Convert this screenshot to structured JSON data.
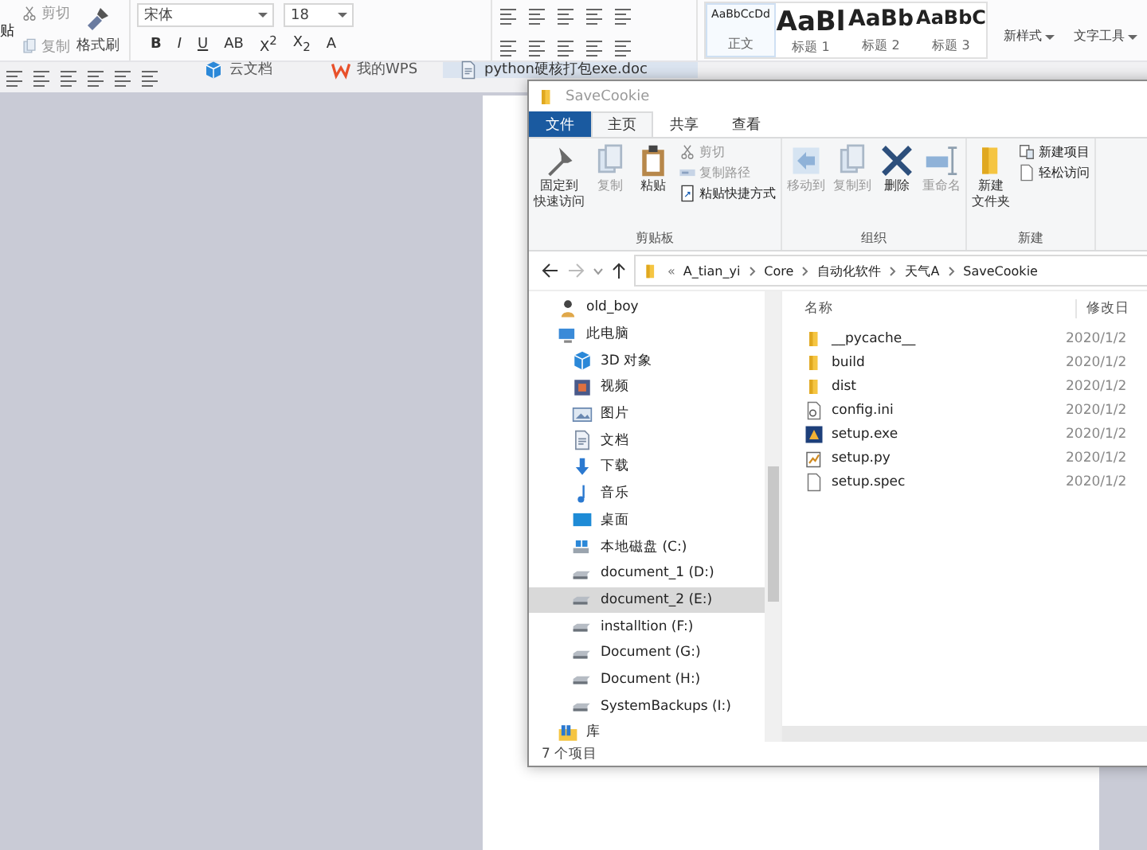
{
  "wps": {
    "clipboard": [
      {
        "label": "剪切"
      },
      {
        "label": "复制"
      },
      {
        "label": "格式刷"
      }
    ],
    "paste_label": "贴",
    "font": {
      "family": "宋体",
      "size": "18"
    },
    "format_buttons": [
      "B",
      "I",
      "U",
      "AB",
      "X$^{2}$",
      "X$_{2}$",
      "A"
    ],
    "styles": [
      {
        "sample": "AaBbCcDd",
        "label": "正文",
        "kind": "body",
        "selected": true
      },
      {
        "sample": "AaBl",
        "label": "标题 1",
        "kind": "h1",
        "selected": false
      },
      {
        "sample": "AaBb",
        "label": "标题 2",
        "kind": "h2",
        "selected": false
      },
      {
        "sample": "AaBbC",
        "label": "标题 3",
        "kind": "h3",
        "selected": false
      }
    ],
    "tools": [
      "新样式",
      "文字工具"
    ],
    "tabs": [
      {
        "label": "云文档",
        "kind": "cloud",
        "selected": false
      },
      {
        "label": "我的WPS",
        "kind": "wps",
        "selected": false
      },
      {
        "label": "python硬核打包exe.doc",
        "kind": "doc",
        "selected": true
      }
    ]
  },
  "explorer": {
    "title": "SaveCookie",
    "tabs": [
      {
        "label": "文件",
        "kind": "file",
        "selected": false
      },
      {
        "label": "主页",
        "kind": "tab",
        "selected": true
      },
      {
        "label": "共享",
        "kind": "tab",
        "selected": false
      },
      {
        "label": "查看",
        "kind": "tab",
        "selected": false
      }
    ],
    "groups": [
      {
        "label": "剪贴板",
        "items": [
          {
            "kind": "large",
            "lines": [
              "固定到",
              "快速访问"
            ],
            "disabled": false
          },
          {
            "kind": "large",
            "lines": [
              "复制"
            ],
            "disabled": true
          },
          {
            "kind": "large",
            "lines": [
              "粘贴"
            ],
            "disabled": false
          },
          {
            "kind": "small",
            "lines": [
              "剪切"
            ],
            "disabled": true
          },
          {
            "kind": "small",
            "lines": [
              "复制路径"
            ],
            "disabled": true
          },
          {
            "kind": "small",
            "lines": [
              "粘贴快捷方式"
            ],
            "disabled": false
          }
        ]
      },
      {
        "label": "组织",
        "items": [
          {
            "kind": "large",
            "lines": [
              "移动到"
            ],
            "disabled": true
          },
          {
            "kind": "large",
            "lines": [
              "复制到"
            ],
            "disabled": true
          },
          {
            "kind": "large",
            "lines": [
              "删除"
            ],
            "disabled": false
          },
          {
            "kind": "large",
            "lines": [
              "重命名"
            ],
            "disabled": true
          }
        ]
      },
      {
        "label": "新建",
        "items": [
          {
            "kind": "large",
            "lines": [
              "新建",
              "文件夹"
            ],
            "disabled": false
          },
          {
            "kind": "small",
            "lines": [
              "新建项目"
            ],
            "disabled": false
          },
          {
            "kind": "small",
            "lines": [
              "轻松访问"
            ],
            "disabled": false
          }
        ]
      }
    ],
    "address": {
      "overflow": "«",
      "crumbs": [
        "A_tian_yi",
        "Core",
        "自动化软件",
        "天气A",
        "SaveCookie"
      ]
    },
    "nav": [
      {
        "label": "old_boy",
        "kind": "user",
        "selected": false
      },
      {
        "label": "此电脑",
        "kind": "pc",
        "selected": false,
        "children": [
          {
            "label": "3D 对象",
            "kind": "cube",
            "selected": false
          },
          {
            "label": "视频",
            "kind": "video",
            "selected": false
          },
          {
            "label": "图片",
            "kind": "picture",
            "selected": false
          },
          {
            "label": "文档",
            "kind": "document",
            "selected": false
          },
          {
            "label": "下载",
            "kind": "download",
            "selected": false
          },
          {
            "label": "音乐",
            "kind": "music",
            "selected": false
          },
          {
            "label": "桌面",
            "kind": "desktop",
            "selected": false
          },
          {
            "label": "本地磁盘 (C:)",
            "kind": "sysdrive",
            "selected": false
          },
          {
            "label": "document_1 (D:)",
            "kind": "drive",
            "selected": false
          },
          {
            "label": "document_2 (E:)",
            "kind": "drive",
            "selected": true
          },
          {
            "label": "installtion (F:)",
            "kind": "drive",
            "selected": false
          },
          {
            "label": "Document (G:)",
            "kind": "drive",
            "selected": false
          },
          {
            "label": "Document (H:)",
            "kind": "drive",
            "selected": false
          },
          {
            "label": "SystemBackups (I:)",
            "kind": "drive",
            "selected": false
          }
        ]
      },
      {
        "label": "库",
        "kind": "library",
        "selected": false
      }
    ],
    "columns": [
      "名称",
      "修改日"
    ],
    "files": [
      {
        "name": "__pycache__",
        "kind": "folder",
        "modified": "2020/1/2"
      },
      {
        "name": "build",
        "kind": "folder",
        "modified": "2020/1/2"
      },
      {
        "name": "dist",
        "kind": "folder",
        "modified": "2020/1/2"
      },
      {
        "name": "config.ini",
        "kind": "settings",
        "modified": "2020/1/2"
      },
      {
        "name": "setup.exe",
        "kind": "exe",
        "modified": "2020/1/2"
      },
      {
        "name": "setup.py",
        "kind": "py",
        "modified": "2020/1/2"
      },
      {
        "name": "setup.spec",
        "kind": "file",
        "modified": "2020/1/2"
      }
    ],
    "status": "7 个项目"
  }
}
